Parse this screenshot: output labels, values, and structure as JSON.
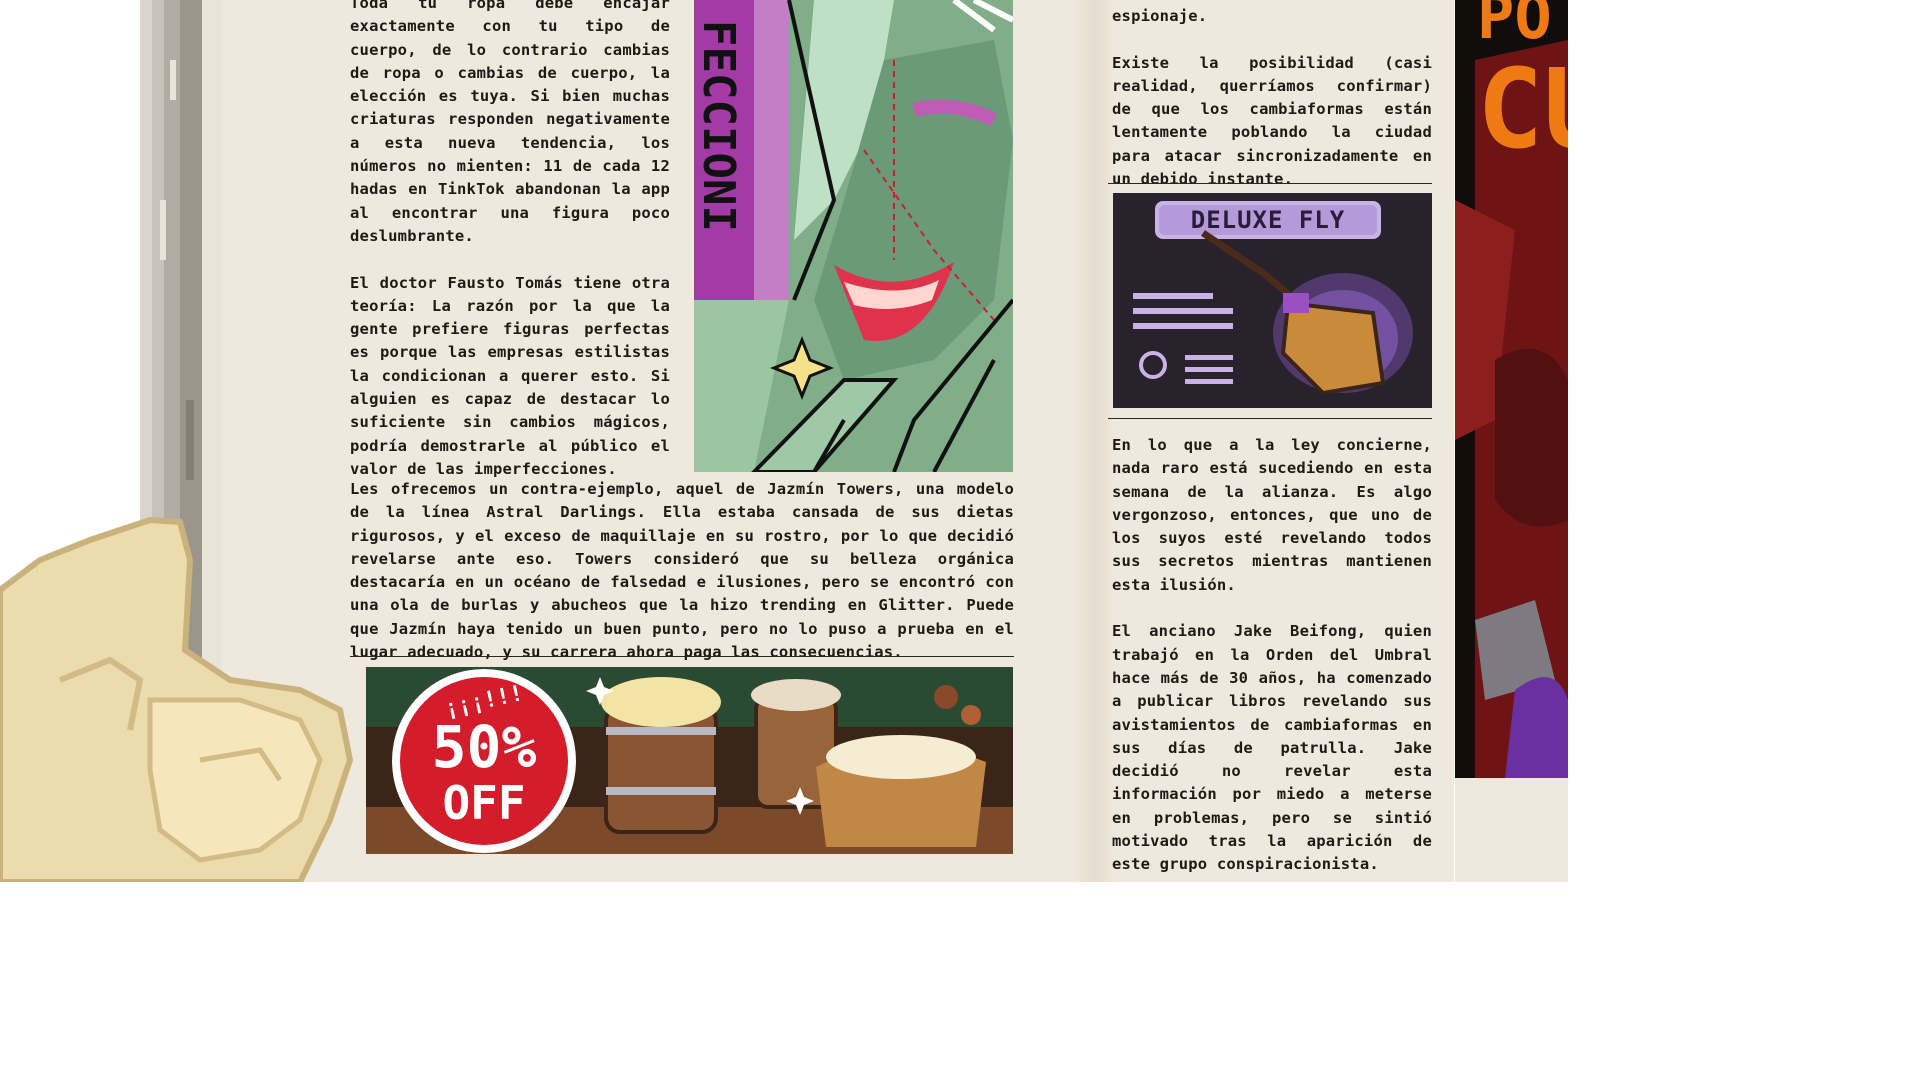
{
  "article": {
    "left_top": [
      "Toda tu ropa debe encajar exactamente con tu tipo de cuerpo, de lo contrario cambias de ropa o cambias de cuerpo, la elección es tuya. Si bien muchas criaturas responden negativamente a esta nueva tendencia, los números no mienten: 11 de cada 12 hadas en TinkTok abandonan la app al encontrar una figura poco deslumbrante.",
      "El doctor Fausto Tomás tiene otra teoría: La razón por la que la gente prefiere figuras perfectas es porque las empresas estilistas la condicionan a querer esto. Si alguien es capaz de destacar lo suficiente sin cambios mágicos, podría demostrarle al público el valor de las imperfecciones."
    ],
    "left_bottom": "Les ofrecemos un contra-ejemplo, aquel de Jazmín Towers, una modelo de la línea Astral Darlings. Ella estaba cansada de sus dietas rigurosos, y el exceso de maquillaje en su rostro, por lo que decidió revelarse ante eso. Towers consideró que su belleza orgánica destacaría en un océano de falsedad e ilusiones, pero se encontró con una ola de burlas y abucheos que la hizo trending en Glitter. Puede que Jazmín haya tenido un buen punto, pero no lo puso a prueba en el lugar adecuado, y su carrera ahora paga las consecuencias.",
    "right_top": [
      "espionaje.",
      "Existe la posibilidad (casi realidad, querríamos confirmar) de que los cambiaformas están lentamente poblando la ciudad para atacar sincronizadamente en un debido instante."
    ],
    "right_bottom": [
      "En lo que a la ley concierne, nada raro está sucediendo en esta semana de la alianza. Es algo vergonzoso, entonces, que uno de los suyos esté revelando todos sus secretos mientras mantienen esta ilusión.",
      "El anciano Jake Beifong, quien trabajó en la Orden del Umbral hace más de 30 años, ha comenzado a publicar libros revelando sus avistamientos de cambiaformas en sus días de patrulla. Jake decidió no revelar esta información por miedo a meterse en problemas, pero se sintió motivado tras la aparición de este grupo conspiracionista."
    ]
  },
  "comic": {
    "side_text": "FECCIONI",
    "panel_subject": "green-skinned woman smiling"
  },
  "ads": {
    "broom": {
      "title": "DELUXE FLY"
    },
    "tavern": {
      "badge_top": "¡¡¡!!!",
      "badge_percent": "50%",
      "badge_off": "OFF"
    }
  },
  "poster": {
    "text_1": "PO",
    "text_2": "CU"
  },
  "colors": {
    "paper": "#efe8dc",
    "ink": "#1d1a17",
    "badge_red": "#d41c2a",
    "poster_orange": "#f07a12",
    "poster_red": "#7a1616",
    "comic_green": "#8fb796",
    "magenta": "#a33aa6"
  }
}
